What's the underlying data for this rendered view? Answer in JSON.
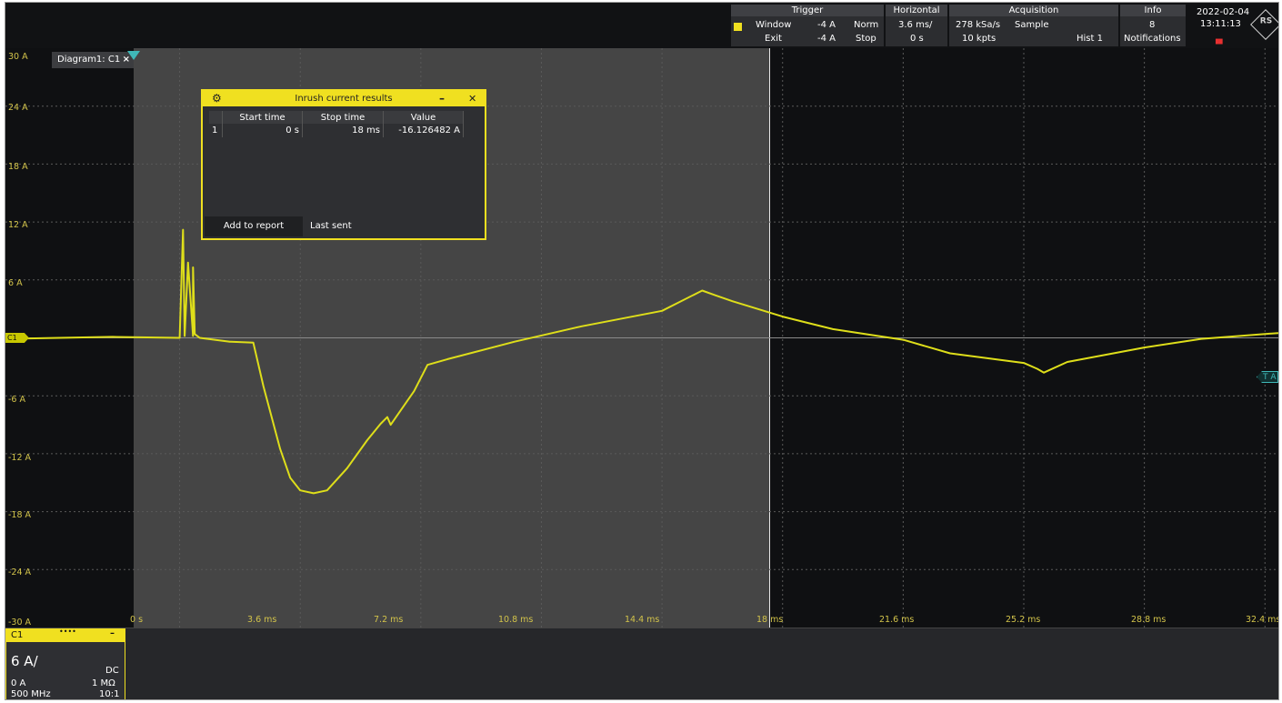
{
  "trigger": {
    "header": "Trigger",
    "mode1": "Window",
    "level1": "-4 A",
    "type": "Norm",
    "mode2": "Exit",
    "level2": "-4 A",
    "state": "Stop"
  },
  "horizontal": {
    "header": "Horizontal",
    "scale": "3.6 ms/",
    "position": "0 s"
  },
  "acquisition": {
    "header": "Acquisition",
    "rate": "278 kSa/s",
    "mode": "Sample",
    "points": "10 kpts",
    "hist": "Hist 1"
  },
  "info": {
    "header": "Info",
    "count": "8",
    "label": "Notifications"
  },
  "clock": {
    "date": "2022-02-04",
    "time": "13:11:13"
  },
  "diagram": {
    "tab_label": "Diagram1: C1",
    "tab_close": "×",
    "y_labels": [
      "30 A",
      "24 A",
      "18 A",
      "12 A",
      "6 A",
      "-6 A",
      "-12 A",
      "-18 A",
      "-24 A",
      "-30 A"
    ],
    "x_labels": [
      "0 s",
      "3.6 ms",
      "7.2 ms",
      "10.8 ms",
      "14.4 ms",
      "18 ms",
      "21.6 ms",
      "25.2 ms",
      "28.8 ms",
      "32.4 ms"
    ],
    "offset_marker": "C1",
    "trigger_marker": "T A"
  },
  "results": {
    "title": "Inrush current results",
    "columns": [
      "",
      "Start time",
      "Stop time",
      "Value"
    ],
    "rows": [
      [
        "1",
        "0 s",
        "18 ms",
        "-16.126482 A"
      ]
    ],
    "add_button": "Add to report",
    "last_sent": "Last sent"
  },
  "channel": {
    "name": "C1",
    "dots": "••••",
    "scale": "6 A/",
    "coupling": "DC",
    "offset": "0 A",
    "impedance": "1 MΩ",
    "bandwidth": "500 MHz",
    "probe": "10:1"
  },
  "chart_data": {
    "type": "line",
    "xlabel": "",
    "ylabel": "",
    "xlim": [
      -5.2,
      32.8
    ],
    "ylim": [
      -30,
      30
    ],
    "series": [
      {
        "color": "#dede1a",
        "x": [
          -5.2,
          -2,
          0,
          0.1,
          0.15,
          0.25,
          0.4,
          0.4,
          0.45,
          0.6,
          1.5,
          2.2,
          2.5,
          3.0,
          3.3,
          3.6,
          4.0,
          4.4,
          5.0,
          5.6,
          6.0,
          6.2,
          6.3,
          7.0,
          7.4,
          8.0,
          10.0,
          12.0,
          14.4,
          15.6,
          16.0,
          16.5,
          18.0,
          19.5,
          21.6,
          23.0,
          25.2,
          25.6,
          25.8,
          26.5,
          28.8,
          30.5,
          32.8
        ],
        "y": [
          -0.1,
          0.1,
          0,
          11.2,
          0.2,
          7.8,
          0.2,
          7.3,
          0.4,
          0,
          -0.4,
          -0.5,
          -5,
          -11.5,
          -14.5,
          -15.8,
          -16.1,
          -15.8,
          -13.5,
          -10.6,
          -8.9,
          -8.2,
          -9,
          -5.5,
          -2.8,
          -2.2,
          -0.4,
          1.2,
          2.8,
          4.9,
          4.4,
          3.8,
          2.2,
          0.9,
          -0.2,
          -1.6,
          -2.6,
          -3.2,
          -3.6,
          -2.5,
          -1.0,
          -0.1,
          0.5
        ]
      }
    ]
  }
}
